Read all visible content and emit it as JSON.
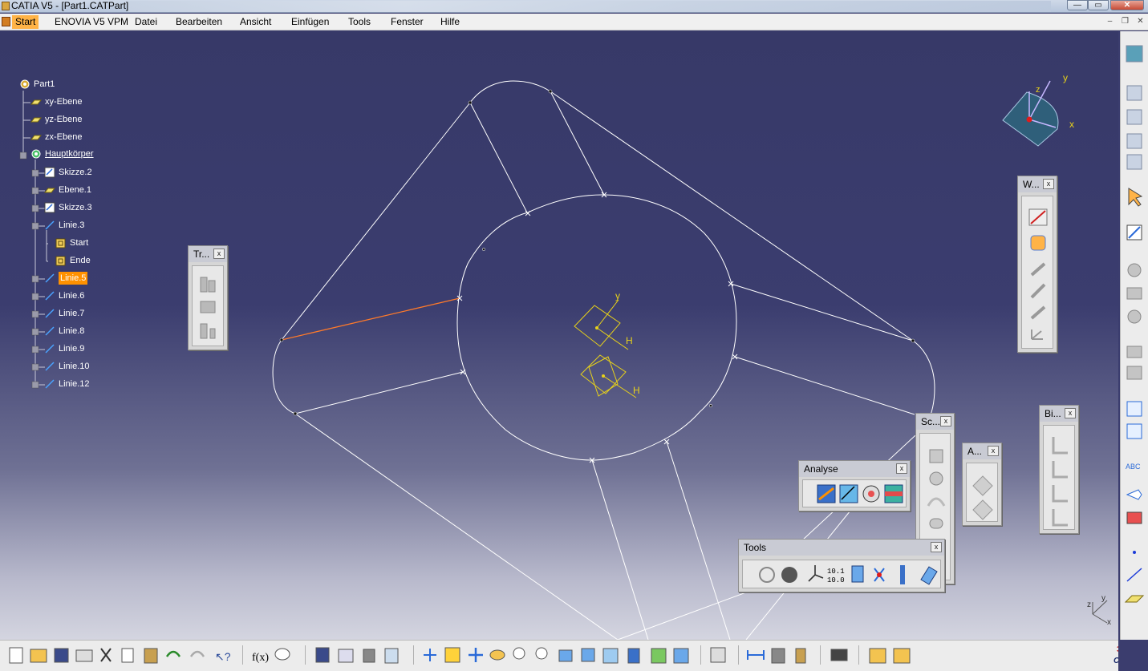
{
  "window": {
    "title": "CATIA V5 - [Part1.CATPart]",
    "min_label": "—",
    "max_label": "▭",
    "close_label": "✕"
  },
  "menubar": {
    "items": [
      {
        "label": "Start",
        "active": true
      },
      {
        "label": "ENOVIA V5 VPM"
      },
      {
        "label": "Datei"
      },
      {
        "label": "Bearbeiten"
      },
      {
        "label": "Ansicht"
      },
      {
        "label": "Einfügen"
      },
      {
        "label": "Tools"
      },
      {
        "label": "Fenster"
      },
      {
        "label": "Hilfe"
      }
    ],
    "mdi_min": "–",
    "mdi_restore": "❐",
    "mdi_close": "✕"
  },
  "tree": {
    "nodes": [
      {
        "label": "Part1",
        "icon": "part-icon"
      },
      {
        "label": "xy-Ebene",
        "icon": "plane-icon"
      },
      {
        "label": "yz-Ebene",
        "icon": "plane-icon"
      },
      {
        "label": "zx-Ebene",
        "icon": "plane-icon"
      },
      {
        "label": "Hauptkörper",
        "icon": "body-icon",
        "underlined": true
      },
      {
        "label": "Skizze.2",
        "icon": "sketch-icon"
      },
      {
        "label": "Ebene.1",
        "icon": "plane-icon"
      },
      {
        "label": "Skizze.3",
        "icon": "sketch-icon"
      },
      {
        "label": "Linie.3",
        "icon": "line-icon"
      },
      {
        "label": "Start",
        "icon": "point-icon"
      },
      {
        "label": "Ende",
        "icon": "point-icon"
      },
      {
        "label": "Linie.5",
        "icon": "line-icon",
        "selected": true
      },
      {
        "label": "Linie.6",
        "icon": "line-icon"
      },
      {
        "label": "Linie.7",
        "icon": "line-icon"
      },
      {
        "label": "Linie.8",
        "icon": "line-icon"
      },
      {
        "label": "Linie.9",
        "icon": "line-icon"
      },
      {
        "label": "Linie.10",
        "icon": "line-icon"
      },
      {
        "label": "Linie.12",
        "icon": "line-icon"
      }
    ]
  },
  "compass": {
    "x_label": "x",
    "y_label": "y",
    "z_label": "z"
  },
  "axis_triad": {
    "x_label": "x",
    "y_label": "y",
    "z_label": "z"
  },
  "sketch_labels": {
    "y": "y",
    "h1": "H",
    "h2": "H"
  },
  "toolbars": {
    "transformations": {
      "title": "Tr...",
      "close": "x"
    },
    "wireframe": {
      "title": "W...",
      "close": "x"
    },
    "sketch": {
      "title": "Sc...",
      "close": "x"
    },
    "analysis_small": {
      "title": "A...",
      "close": "x"
    },
    "bi": {
      "title": "Bi...",
      "close": "x"
    },
    "analyse": {
      "title": "Analyse",
      "close": "x"
    },
    "tools": {
      "title": "Tools",
      "close": "x"
    }
  },
  "colors": {
    "background_top": "#373968",
    "background_bottom": "#d4d5e0",
    "wire": "#ffffff",
    "selected_line": "#ff7a2a",
    "tree_selected": "#ff9100",
    "sketch_yellow": "#e8d21a"
  }
}
